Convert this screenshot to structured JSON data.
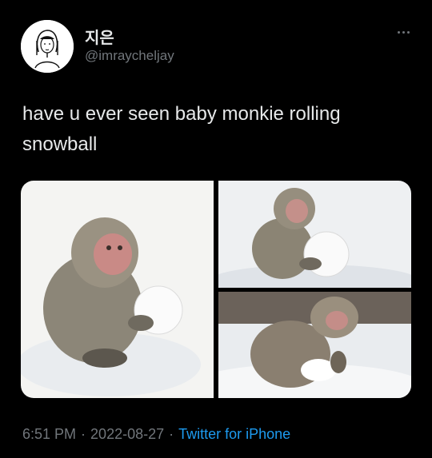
{
  "author": {
    "display_name": "지은",
    "handle": "@imraycheljay",
    "avatar_icon": "avatar-sketch-girl"
  },
  "tweet": {
    "text": "have u ever seen baby monkie rolling snowball"
  },
  "media": {
    "photo_count": 3,
    "photos": [
      "monkey-snowball-photo-1",
      "monkey-snowball-photo-2",
      "monkey-snowball-photo-3"
    ]
  },
  "meta": {
    "time": "6:51 PM",
    "separator": "·",
    "date": "2022-08-27",
    "source": "Twitter for iPhone"
  },
  "colors": {
    "background": "#000000",
    "text": "#e7e9ea",
    "muted": "#71767b",
    "link": "#1d9bf0"
  }
}
